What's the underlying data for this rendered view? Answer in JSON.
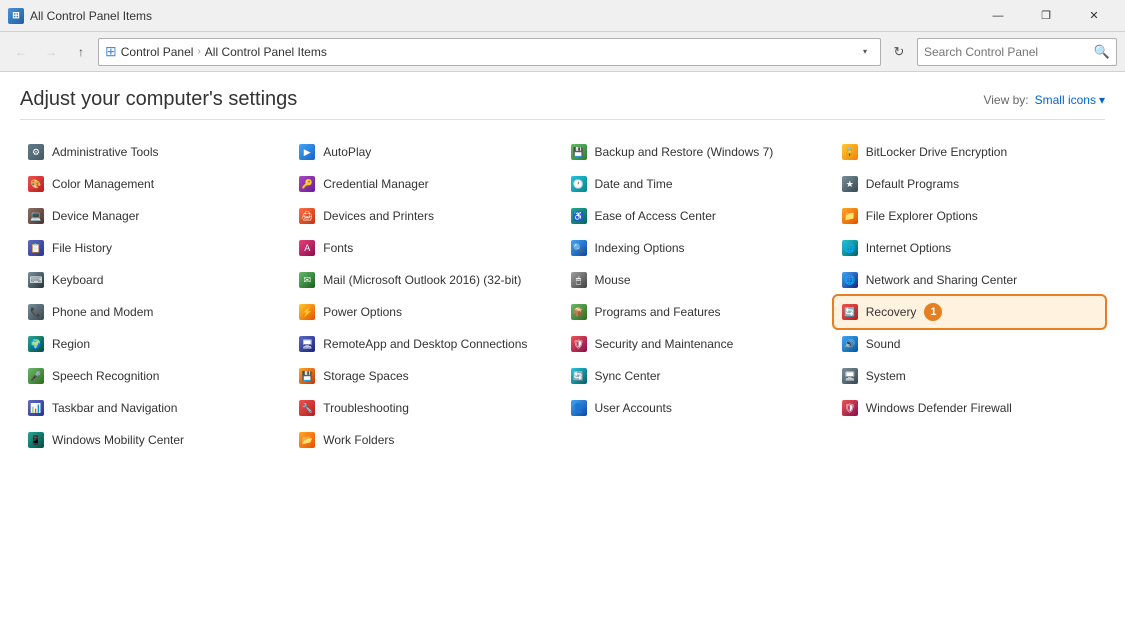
{
  "titlebar": {
    "title": "All Control Panel Items",
    "icon": "CP",
    "minimize_label": "—",
    "restore_label": "❐",
    "close_label": "✕"
  },
  "addressbar": {
    "back_title": "Back",
    "forward_title": "Forward",
    "up_title": "Up",
    "breadcrumbs": [
      "Control Panel",
      "All Control Panel Items"
    ],
    "refresh_title": "Refresh",
    "search_placeholder": "Search Control Panel"
  },
  "header": {
    "title": "Adjust your computer's settings",
    "view_by_label": "View by:",
    "view_value": "Small icons",
    "view_dropdown": "▾"
  },
  "items": [
    {
      "id": "admin-tools",
      "label": "Administrative Tools",
      "icon": "admin"
    },
    {
      "id": "autoplay",
      "label": "AutoPlay",
      "icon": "autoplay"
    },
    {
      "id": "backup-restore",
      "label": "Backup and Restore (Windows 7)",
      "icon": "backup"
    },
    {
      "id": "bitlocker",
      "label": "BitLocker Drive Encryption",
      "icon": "bitlocker"
    },
    {
      "id": "color-mgmt",
      "label": "Color Management",
      "icon": "color"
    },
    {
      "id": "credential-mgr",
      "label": "Credential Manager",
      "icon": "credential"
    },
    {
      "id": "date-time",
      "label": "Date and Time",
      "icon": "datetime"
    },
    {
      "id": "default-programs",
      "label": "Default Programs",
      "icon": "default"
    },
    {
      "id": "device-manager",
      "label": "Device Manager",
      "icon": "device"
    },
    {
      "id": "devices-printers",
      "label": "Devices and Printers",
      "icon": "devprinter"
    },
    {
      "id": "ease-access",
      "label": "Ease of Access Center",
      "icon": "ease"
    },
    {
      "id": "file-explorer-options",
      "label": "File Explorer Options",
      "icon": "fileexp"
    },
    {
      "id": "file-history",
      "label": "File History",
      "icon": "filehist"
    },
    {
      "id": "fonts",
      "label": "Fonts",
      "icon": "fonts"
    },
    {
      "id": "indexing-options",
      "label": "Indexing Options",
      "icon": "indexing"
    },
    {
      "id": "internet-options",
      "label": "Internet Options",
      "icon": "internet"
    },
    {
      "id": "keyboard",
      "label": "Keyboard",
      "icon": "keyboard"
    },
    {
      "id": "mail",
      "label": "Mail (Microsoft Outlook 2016) (32-bit)",
      "icon": "mail"
    },
    {
      "id": "mouse",
      "label": "Mouse",
      "icon": "mouse"
    },
    {
      "id": "network-sharing",
      "label": "Network and Sharing Center",
      "icon": "network"
    },
    {
      "id": "phone-modem",
      "label": "Phone and Modem",
      "icon": "phone"
    },
    {
      "id": "power-options",
      "label": "Power Options",
      "icon": "power"
    },
    {
      "id": "programs-features",
      "label": "Programs and Features",
      "icon": "programs"
    },
    {
      "id": "recovery",
      "label": "Recovery",
      "icon": "recovery",
      "highlighted": true,
      "badge": "1"
    },
    {
      "id": "region",
      "label": "Region",
      "icon": "region"
    },
    {
      "id": "remote-app",
      "label": "RemoteApp and Desktop Connections",
      "icon": "remote"
    },
    {
      "id": "security-maintenance",
      "label": "Security and Maintenance",
      "icon": "security"
    },
    {
      "id": "sound",
      "label": "Sound",
      "icon": "sound"
    },
    {
      "id": "speech-recog",
      "label": "Speech Recognition",
      "icon": "speech"
    },
    {
      "id": "storage-spaces",
      "label": "Storage Spaces",
      "icon": "storage"
    },
    {
      "id": "sync-center",
      "label": "Sync Center",
      "icon": "sync"
    },
    {
      "id": "system",
      "label": "System",
      "icon": "system"
    },
    {
      "id": "taskbar-nav",
      "label": "Taskbar and Navigation",
      "icon": "taskbar"
    },
    {
      "id": "troubleshooting",
      "label": "Troubleshooting",
      "icon": "trouble"
    },
    {
      "id": "user-accounts",
      "label": "User Accounts",
      "icon": "useracc"
    },
    {
      "id": "win-defender",
      "label": "Windows Defender Firewall",
      "icon": "wdefend"
    },
    {
      "id": "win-mobility",
      "label": "Windows Mobility Center",
      "icon": "wmobil"
    },
    {
      "id": "work-folders",
      "label": "Work Folders",
      "icon": "workfold"
    }
  ],
  "icon_chars": {
    "admin": "⚙",
    "autoplay": "▶",
    "backup": "💾",
    "bitlocker": "🔒",
    "color": "🎨",
    "credential": "🔑",
    "datetime": "🕐",
    "default": "★",
    "device": "💻",
    "devprinter": "🖨",
    "ease": "♿",
    "fileexp": "📁",
    "filehist": "📋",
    "fonts": "A",
    "indexing": "🔍",
    "internet": "🌐",
    "keyboard": "⌨",
    "mail": "✉",
    "mouse": "🖱",
    "network": "🌐",
    "phone": "📞",
    "power": "⚡",
    "programs": "📦",
    "recovery": "🔄",
    "region": "🌍",
    "remote": "🖥",
    "security": "🛡",
    "sound": "🔊",
    "speech": "🎤",
    "storage": "💾",
    "sync": "🔄",
    "system": "🖥",
    "taskbar": "📊",
    "trouble": "🔧",
    "useracc": "👤",
    "wdefend": "🛡",
    "wmobil": "📱",
    "workfold": "📂"
  }
}
